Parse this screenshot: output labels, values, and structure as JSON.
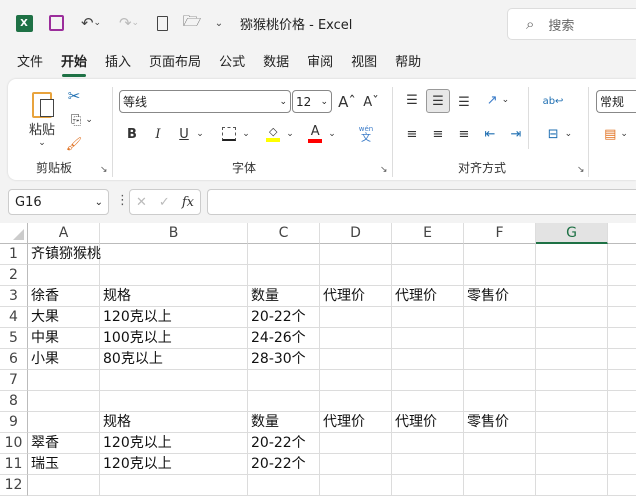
{
  "titlebar": {
    "title": "猕猴桃价格  -  Excel",
    "search_placeholder": "搜索"
  },
  "tabs": [
    "文件",
    "开始",
    "插入",
    "页面布局",
    "公式",
    "数据",
    "审阅",
    "视图",
    "帮助"
  ],
  "ribbon": {
    "clipboard": {
      "paste": "粘贴",
      "label": "剪贴板"
    },
    "font": {
      "name": "等线",
      "size": "12",
      "label": "字体",
      "bold": "B",
      "italic": "I",
      "underline": "U",
      "font_color": "A",
      "phonetic_top": "wén",
      "phonetic_bottom": "文"
    },
    "alignment": {
      "label": "对齐方式"
    },
    "number": {
      "format": "常规"
    }
  },
  "formula_bar": {
    "name_box": "G16",
    "fx": "fx",
    "value": ""
  },
  "colors": {
    "accent": "#1e7145",
    "highlight": "#ffff00",
    "font_color": "#ff0000"
  },
  "sheet": {
    "columns": [
      "A",
      "B",
      "C",
      "D",
      "E",
      "F",
      "G"
    ],
    "selected_column": "G",
    "rows": [
      [
        "1",
        [
          "齐镇猕猴桃",
          "",
          "",
          "",
          "",
          "",
          ""
        ]
      ],
      [
        "2",
        [
          "",
          "",
          "",
          "",
          "",
          "",
          ""
        ]
      ],
      [
        "3",
        [
          "徐香",
          "规格",
          "数量",
          "代理价",
          "代理价",
          "零售价",
          ""
        ]
      ],
      [
        "4",
        [
          "大果",
          "120克以上",
          "20-22个",
          "",
          "",
          "",
          ""
        ]
      ],
      [
        "5",
        [
          "中果",
          "100克以上",
          "24-26个",
          "",
          "",
          "",
          ""
        ]
      ],
      [
        "6",
        [
          "小果",
          "80克以上",
          "28-30个",
          "",
          "",
          "",
          ""
        ]
      ],
      [
        "7",
        [
          "",
          "",
          "",
          "",
          "",
          "",
          ""
        ]
      ],
      [
        "8",
        [
          "",
          "",
          "",
          "",
          "",
          "",
          ""
        ]
      ],
      [
        "9",
        [
          "",
          "规格",
          "数量",
          "代理价",
          "代理价",
          "零售价",
          ""
        ]
      ],
      [
        "10",
        [
          "翠香",
          "120克以上",
          "20-22个",
          "",
          "",
          "",
          ""
        ]
      ],
      [
        "11",
        [
          "瑞玉",
          "120克以上",
          "20-22个",
          "",
          "",
          "",
          ""
        ]
      ],
      [
        "12",
        [
          "",
          "",
          "",
          "",
          "",
          "",
          ""
        ]
      ]
    ]
  }
}
